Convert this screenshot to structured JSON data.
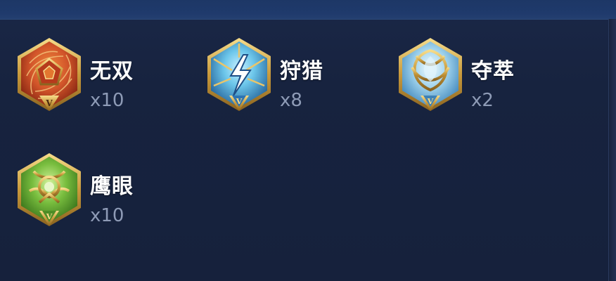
{
  "badges": [
    {
      "name": "无双",
      "count": "x10",
      "icon": "wushuang-emblem-icon",
      "color": "#d2552a",
      "tier": "V"
    },
    {
      "name": "狩猎",
      "count": "x8",
      "icon": "hunting-emblem-icon",
      "color": "#46a9d6",
      "tier": "V"
    },
    {
      "name": "夺萃",
      "count": "x2",
      "icon": "plunder-emblem-icon",
      "color": "#9fd2ec",
      "tier": "V"
    },
    {
      "name": "鹰眼",
      "count": "x10",
      "icon": "hawkeye-emblem-icon",
      "color": "#6fb637",
      "tier": "V"
    }
  ]
}
